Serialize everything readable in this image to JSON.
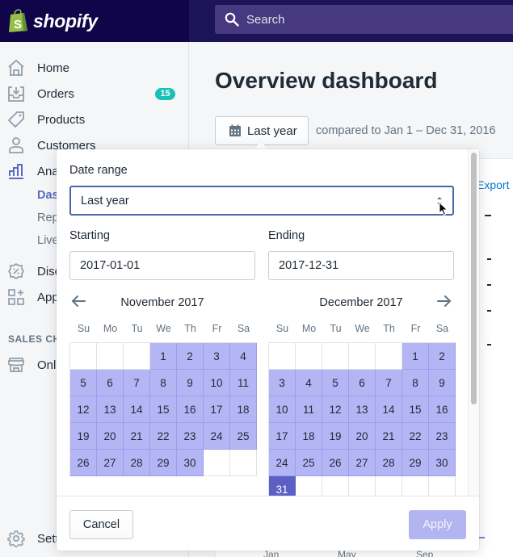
{
  "topbar": {
    "brand": "shopify",
    "search_placeholder": "Search",
    "colors": {
      "brand_bg": "#0f0548",
      "bar_bg": "#1c1456",
      "search_bg": "#47397f",
      "logo_green": "#95bf47"
    }
  },
  "sidebar": {
    "items": [
      {
        "label": "Home",
        "icon": "home-icon"
      },
      {
        "label": "Orders",
        "icon": "orders-icon",
        "badge": "15"
      },
      {
        "label": "Products",
        "icon": "tag-icon"
      },
      {
        "label": "Customers",
        "icon": "customer-icon"
      },
      {
        "label": "Analytics",
        "icon": "analytics-icon",
        "active": true,
        "sub_items": [
          {
            "label": "Dashboards",
            "active": true
          },
          {
            "label": "Reports"
          },
          {
            "label": "Live View"
          }
        ]
      },
      {
        "label": "Discounts",
        "icon": "discount-icon"
      },
      {
        "label": "Apps",
        "icon": "apps-icon"
      }
    ],
    "sales_channels_title": "SALES CHANNELS",
    "sales_channels": [
      {
        "label": "Online Store",
        "icon": "store-icon"
      }
    ],
    "settings_label": "Settings",
    "colors": {
      "active": "#5c6ac4",
      "badge": "#18c1b5"
    }
  },
  "main": {
    "title": "Overview dashboard",
    "range_button_label": "Last year",
    "compare_text": "compared to Jan 1 – Dec 31, 2016",
    "background_card": {
      "link_text": "Export",
      "axis_labels": [
        "Jan",
        "May",
        "Sep"
      ]
    }
  },
  "popover": {
    "date_range_label": "Date range",
    "date_range_value": "Last year",
    "starting_label": "Starting",
    "starting_value": "2017-01-01",
    "ending_label": "Ending",
    "ending_value": "2017-12-31",
    "weekdays": [
      "Su",
      "Mo",
      "Tu",
      "We",
      "Th",
      "Fr",
      "Sa"
    ],
    "calendars": [
      {
        "title": "November 2017",
        "leading_blanks": 3,
        "days": 30,
        "trailing_blanks": 2,
        "selected_day": null
      },
      {
        "title": "December 2017",
        "leading_blanks": 5,
        "days": 31,
        "trailing_blanks": 6,
        "selected_day": 31
      }
    ],
    "cancel_label": "Cancel",
    "apply_label": "Apply",
    "colors": {
      "in_range": "#b3b5f5",
      "selected": "#5c5fc4",
      "apply_disabled": "#b3b5f0",
      "focus_border": "#4767a6"
    }
  }
}
